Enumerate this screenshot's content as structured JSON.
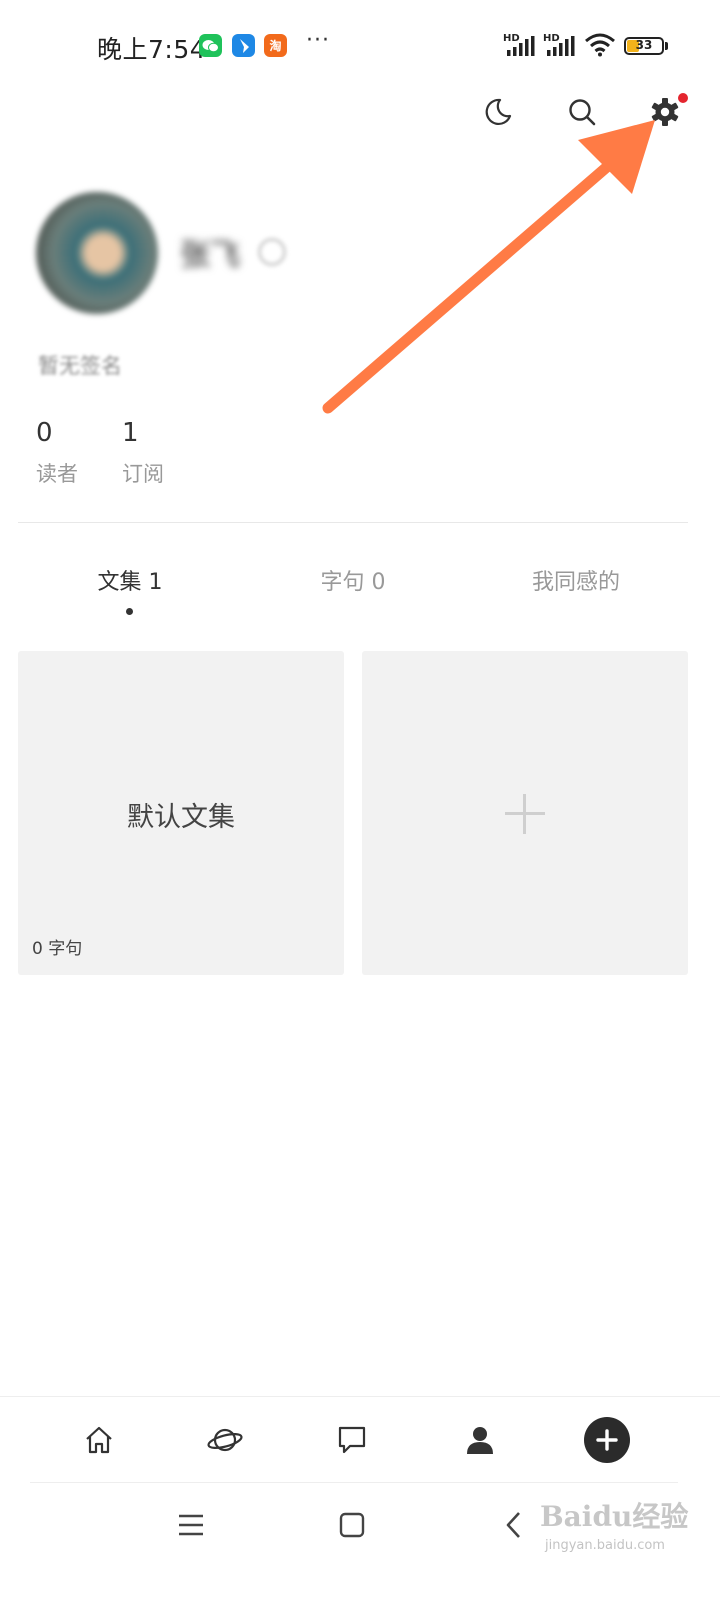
{
  "status_bar": {
    "time": "晚上7:54",
    "more": "···",
    "signal_label": "HD",
    "battery": "33",
    "app_icons": [
      "wechat-icon",
      "bird-app-icon",
      "taobao-icon"
    ]
  },
  "header": {
    "icons": [
      "moon-icon",
      "search-icon",
      "gear-icon"
    ],
    "settings_has_badge": true
  },
  "profile": {
    "name": "张飞",
    "signature": "暂无签名",
    "stats": [
      {
        "value": "0",
        "label": "读者"
      },
      {
        "value": "1",
        "label": "订阅"
      }
    ]
  },
  "tabs": [
    {
      "label": "文集 1",
      "active": true
    },
    {
      "label": "字句 0",
      "active": false
    },
    {
      "label": "我同感的",
      "active": false
    }
  ],
  "collections": [
    {
      "title": "默认文集",
      "count": "0 字句"
    }
  ],
  "bottom_nav": [
    "home-icon",
    "planet-icon",
    "message-icon",
    "profile-icon",
    "add-icon"
  ],
  "system_nav": [
    "menu-icon",
    "home-square-icon",
    "back-icon"
  ],
  "watermark": {
    "text": "Baidu经验",
    "url": "jingyan.baidu.com"
  },
  "colors": {
    "annotation_arrow": "#ff7b45",
    "badge": "#e4252e",
    "card_bg": "#f2f2f2"
  }
}
